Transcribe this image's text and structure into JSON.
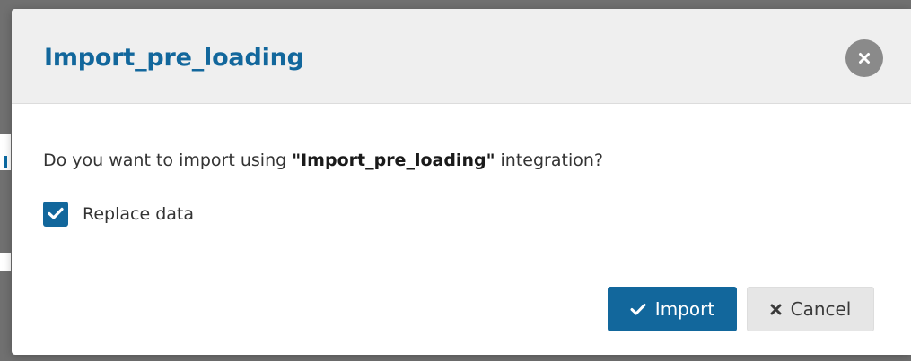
{
  "dialog": {
    "title": "Import_pre_loading",
    "close_icon": "close-icon",
    "message_prefix": "Do you want to import using ",
    "message_integration": "\"Import_pre_loading\"",
    "message_suffix": " integration?",
    "replace_data": {
      "label": "Replace data",
      "checked": true
    },
    "import_button": {
      "label": "Import",
      "icon": "checkmark-icon"
    },
    "cancel_button": {
      "label": "Cancel",
      "icon": "x-icon"
    }
  },
  "colors": {
    "primary": "#12679c",
    "overlay": "#707070",
    "header_bg": "#efefef",
    "close_bg": "#8a8a8a",
    "cancel_bg": "#e6e6e6"
  }
}
